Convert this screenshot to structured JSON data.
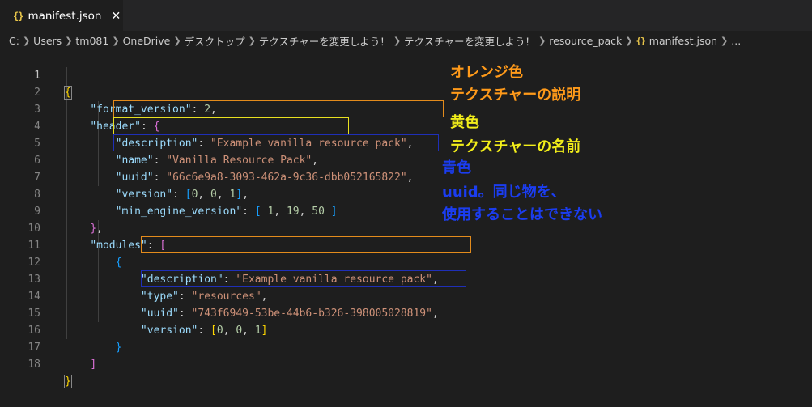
{
  "tab": {
    "icon": "{}",
    "label": "manifest.json",
    "close": "✕"
  },
  "breadcrumb": {
    "items": [
      "C:",
      "Users",
      "tm081",
      "OneDrive",
      "デスクトップ",
      "テクスチャーを変更しよう！",
      "テクスチャーを変更しよう！",
      "resource_pack"
    ],
    "file_icon": "{}",
    "file": "manifest.json",
    "more": "..."
  },
  "editor": {
    "line_numbers": [
      "1",
      "2",
      "3",
      "4",
      "5",
      "6",
      "7",
      "8",
      "9",
      "10",
      "11",
      "12",
      "13",
      "14",
      "15",
      "16",
      "17",
      "18"
    ],
    "tokens": {
      "l1_open": "{",
      "l2_key": "\"format_version\"",
      "l2_val": "2",
      "l3_key": "\"header\"",
      "l3_open": "{",
      "l4_key": "\"description\"",
      "l4_val": "\"Example vanilla resource pack\"",
      "l5_key": "\"name\"",
      "l5_val": "\"Vanilla Resource Pack\"",
      "l6_key": "\"uuid\"",
      "l6_val": "\"66c6e9a8-3093-462a-9c36-dbb052165822\"",
      "l7_key": "\"version\"",
      "l7_open": "[",
      "l7_a": "0",
      "l7_b": "0",
      "l7_c": "1",
      "l7_close": "]",
      "l8_key": "\"min_engine_version\"",
      "l8_open": "[",
      "l8_a": "1",
      "l8_b": "19",
      "l8_c": "50",
      "l8_close": "]",
      "l9_close": "}",
      "l10_key": "\"modules\"",
      "l10_open": "[",
      "l11_open": "{",
      "l12_key": "\"description\"",
      "l12_val": "\"Example vanilla resource pack\"",
      "l13_key": "\"type\"",
      "l13_val": "\"resources\"",
      "l14_key": "\"uuid\"",
      "l14_val": "\"743f6949-53be-44b6-b326-398005028819\"",
      "l15_key": "\"version\"",
      "l15_open": "[",
      "l15_a": "0",
      "l15_b": "0",
      "l15_c": "1",
      "l15_close": "]",
      "l16_close": "}",
      "l17_close": "]",
      "l18_close": "}"
    }
  },
  "annotations": {
    "orange_title": "オレンジ色",
    "orange_desc": "テクスチャーの説明",
    "yellow_title": "黄色",
    "yellow_desc": "テクスチャーの名前",
    "blue_title": "青色",
    "blue_desc1": "uuid。同じ物を、",
    "blue_desc2": "使用することはできない"
  },
  "colors": {
    "orange": "#e38b1c",
    "yellow": "#e8e020",
    "blue": "#1f2fb8"
  }
}
